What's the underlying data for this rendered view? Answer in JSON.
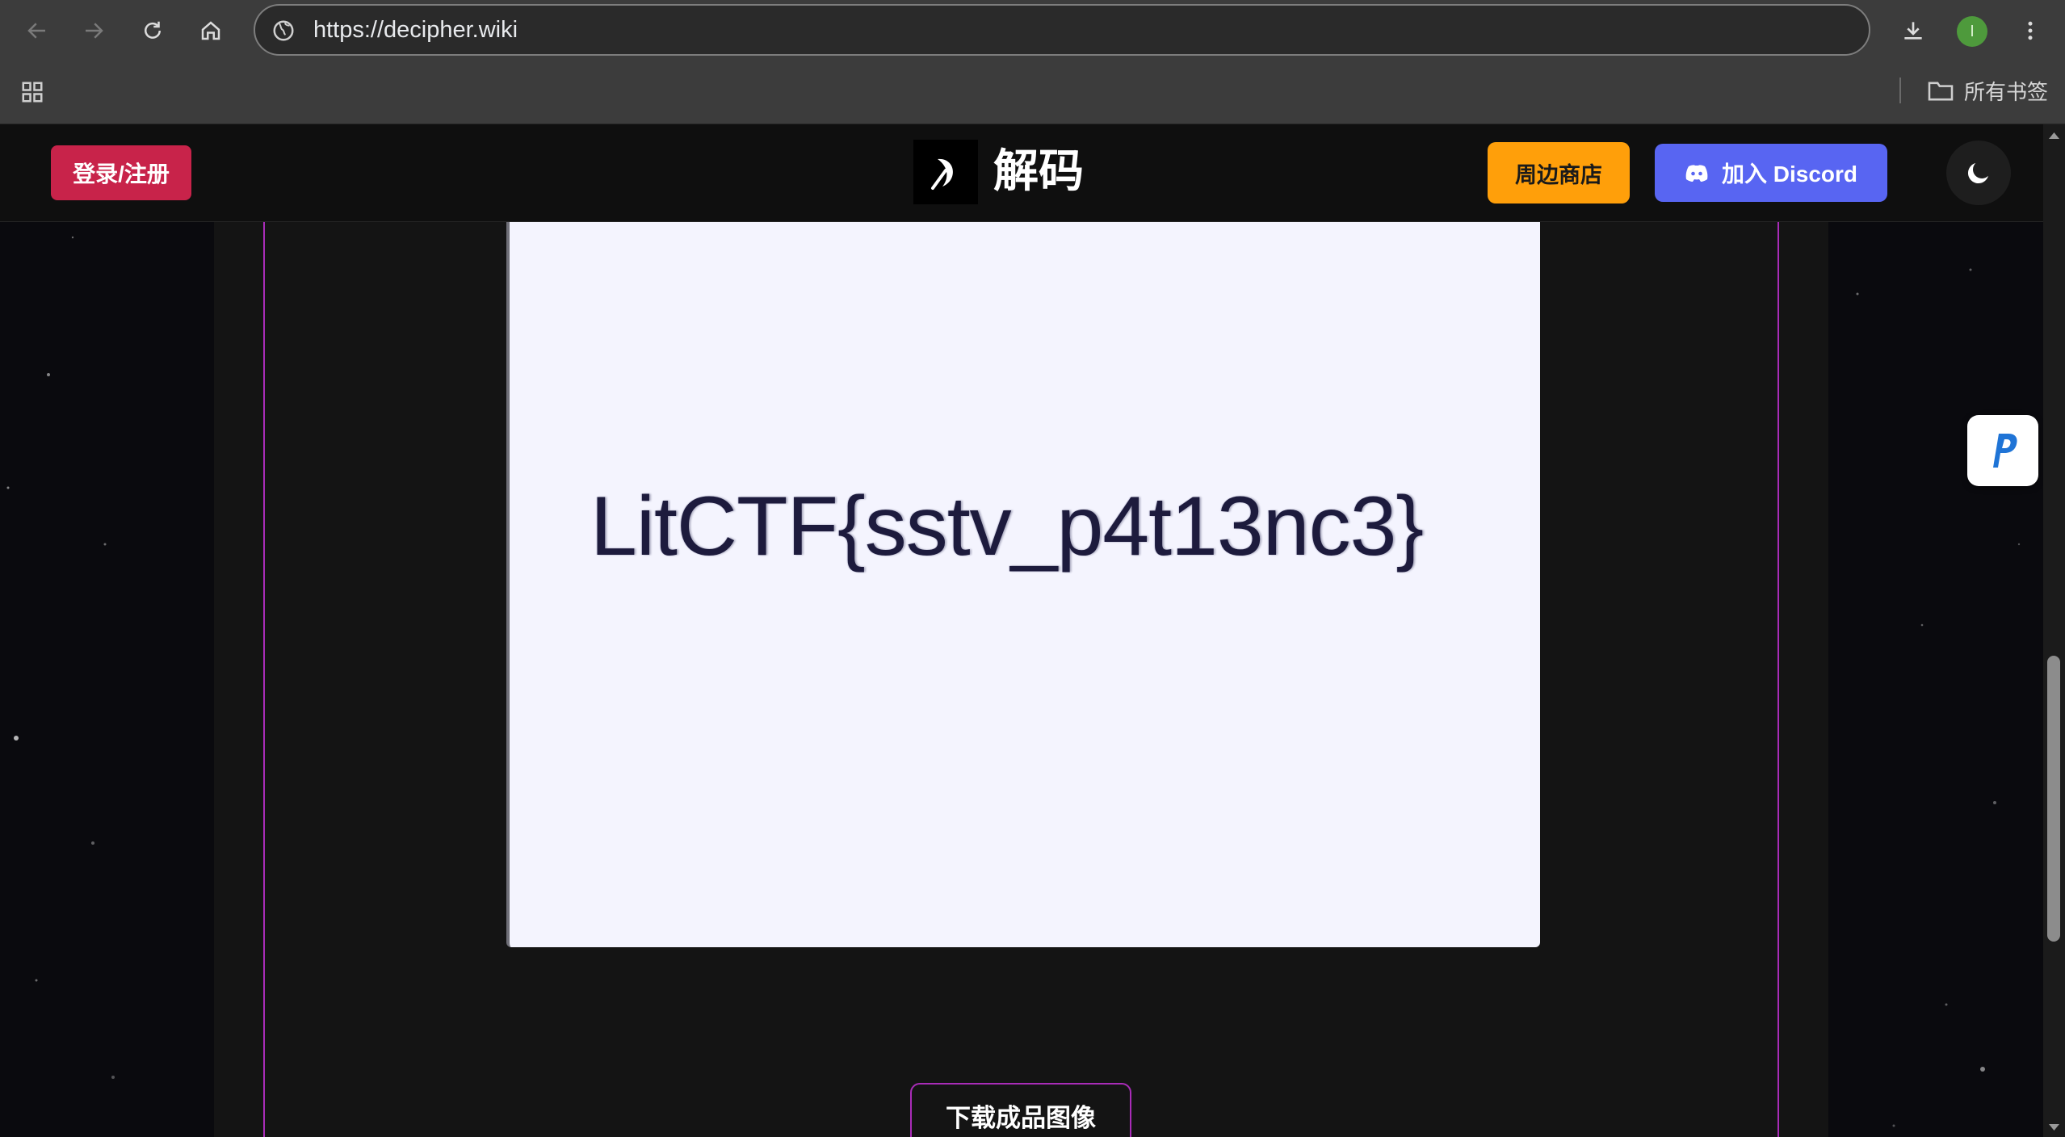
{
  "browser": {
    "url": "https://decipher.wiki",
    "bookmarks_all_label": "所有书签",
    "avatar_letter": "I"
  },
  "header": {
    "login_label": "登录/注册",
    "site_title": "解码",
    "shop_label": "周边商店",
    "discord_label": "加入 Discord"
  },
  "result": {
    "decoded_text": "LitCTF{sstv_p4t13nc3}",
    "download_label": "下载成品图像"
  },
  "colors": {
    "login": "#c8234a",
    "shop": "#ff9f0a",
    "discord": "#5865f2",
    "accent": "#a92cb8"
  }
}
